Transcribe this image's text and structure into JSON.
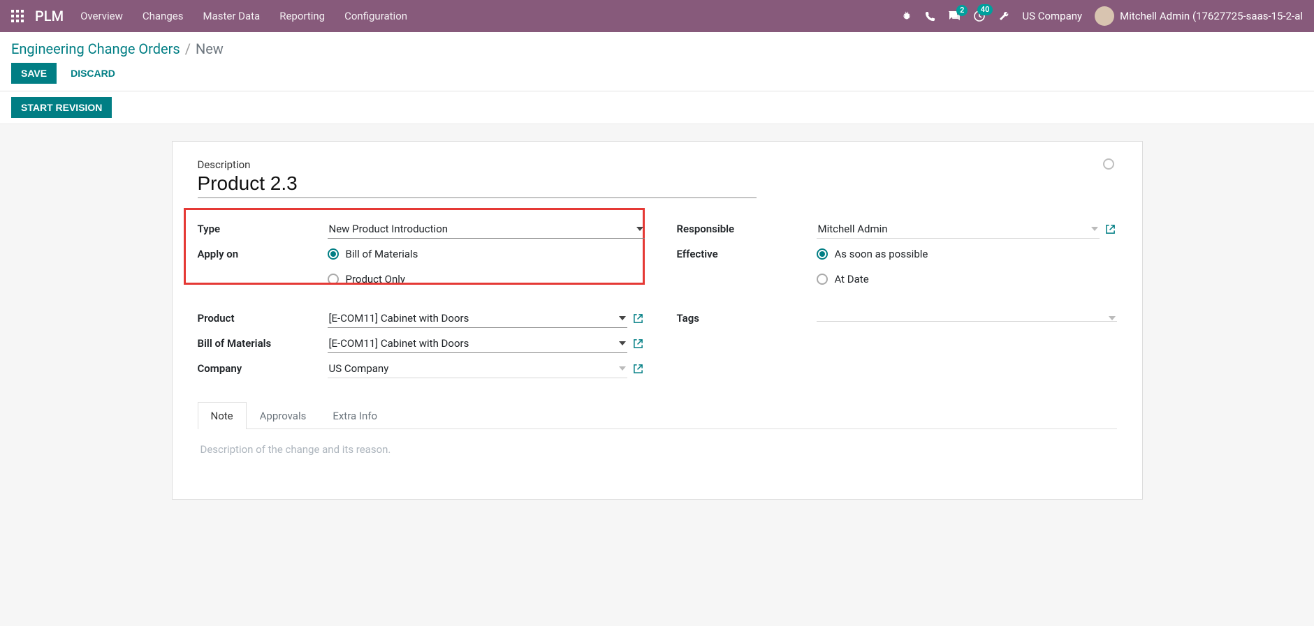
{
  "nav": {
    "brand": "PLM",
    "menu": [
      "Overview",
      "Changes",
      "Master Data",
      "Reporting",
      "Configuration"
    ],
    "tray": {
      "msg_count": "2",
      "activity_count": "40",
      "company": "US Company",
      "user": "Mitchell Admin (17627725-saas-15-2-al"
    }
  },
  "control": {
    "breadcrumb_link": "Engineering Change Orders",
    "breadcrumb_current": "New",
    "save": "SAVE",
    "discard": "DISCARD"
  },
  "status": {
    "start_revision": "START REVISION"
  },
  "form": {
    "desc_label": "Description",
    "desc_value": "Product 2.3",
    "left": {
      "type_label": "Type",
      "type_value": "New Product Introduction",
      "apply_label": "Apply on",
      "apply_bom": "Bill of Materials",
      "apply_product": "Product Only",
      "product_label": "Product",
      "product_value": "[E-COM11] Cabinet with Doors",
      "bom_label": "Bill of Materials",
      "bom_value": "[E-COM11] Cabinet with Doors",
      "company_label": "Company",
      "company_value": "US Company"
    },
    "right": {
      "responsible_label": "Responsible",
      "responsible_value": "Mitchell Admin",
      "effective_label": "Effective",
      "effective_asap": "As soon as possible",
      "effective_at_date": "At Date",
      "tags_label": "Tags",
      "tags_value": ""
    },
    "tabs": {
      "note": "Note",
      "approvals": "Approvals",
      "extra": "Extra Info",
      "note_placeholder": "Description of the change and its reason."
    }
  }
}
